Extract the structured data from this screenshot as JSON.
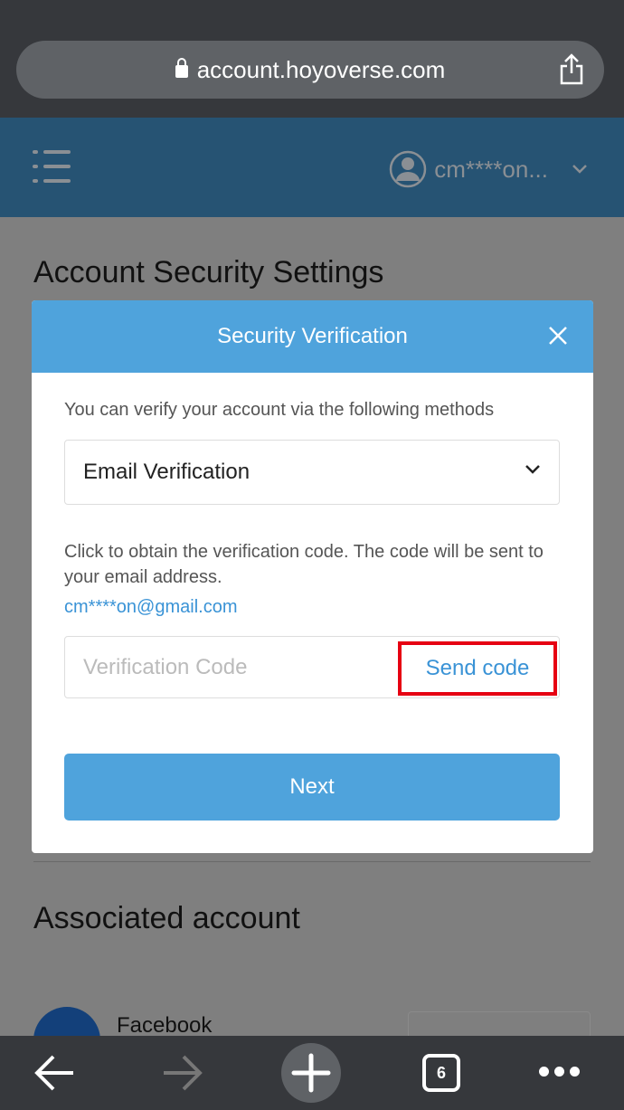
{
  "browser": {
    "url": "account.hoyoverse.com",
    "tab_count": "6"
  },
  "header": {
    "username": "cm****on..."
  },
  "page": {
    "title": "Account Security Settings",
    "associated_title": "Associated account",
    "facebook_label": "Facebook"
  },
  "modal": {
    "title": "Security Verification",
    "description": "You can verify your account via the following methods",
    "method_selected": "Email Verification",
    "info": "Click to obtain the verification code. The code will be sent to your email address.",
    "email": "cm****on@gmail.com",
    "code_placeholder": "Verification Code",
    "send_code": "Send code",
    "next": "Next"
  },
  "colors": {
    "accent": "#4fa3dc",
    "header": "#265373",
    "highlight": "#e60012"
  }
}
